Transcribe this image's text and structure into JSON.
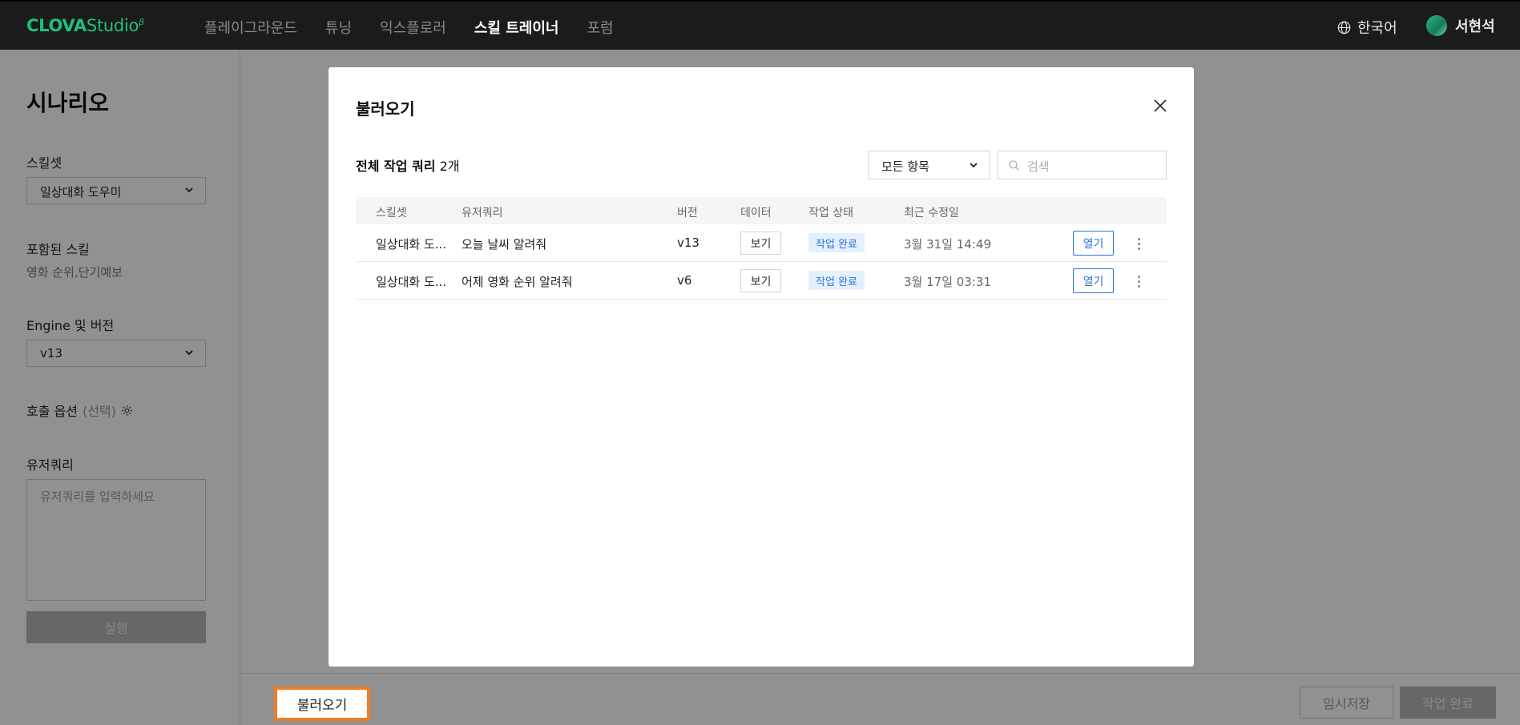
{
  "topbar": {
    "logo_brand": "CLOVA",
    "logo_product": "Studio",
    "logo_mark": "β",
    "nav": [
      "플레이그라운드",
      "튜닝",
      "익스플로러",
      "스킬 트레이너",
      "포럼"
    ],
    "active_nav_index": 3,
    "language": "한국어",
    "user_name": "서현석",
    "icons": {
      "language": "globe-icon",
      "user": "avatar"
    }
  },
  "sidebar": {
    "title": "시나리오",
    "skillset_label": "스킬셋",
    "skillset_value": "일상대화 도우미",
    "included_skills_label": "포함된 스킬",
    "included_skills_value": "영화 순위,단기예보",
    "engine_label": "Engine 및 버전",
    "engine_value": "v13",
    "call_options_label": "호출 옵션",
    "call_options_optional": "(선택)",
    "user_query_label": "유저쿼리",
    "user_query_placeholder": "유저쿼리를 입력하세요",
    "run_button": "실행"
  },
  "footer": {
    "load_button": "불러오기",
    "temp_save_button": "임시저장",
    "complete_button": "작업 완료"
  },
  "modal": {
    "title": "불러오기",
    "count_prefix": "전체 작업 쿼리",
    "count_value": "2개",
    "filter_value": "모든 항목",
    "search_placeholder": "검색",
    "columns": [
      "스킬셋",
      "유저쿼리",
      "버전",
      "데이터",
      "작업 상태",
      "최근 수정일"
    ],
    "rows": [
      {
        "skillset": "일상대화 도...",
        "query": "오늘 날씨 알려줘",
        "version": "v13",
        "data_button": "보기",
        "status": "작업 완료",
        "modified": "3월 31일 14:49",
        "open_button": "열기"
      },
      {
        "skillset": "일상대화 도...",
        "query": "어제 영화 순위 알려줘",
        "version": "v6",
        "data_button": "보기",
        "status": "작업 완료",
        "modified": "3월 17일 03:31",
        "open_button": "열기"
      }
    ]
  },
  "colors": {
    "brand_green": "#1fc07a",
    "accent_blue": "#2a73d8",
    "highlight_orange": "#ef7d22"
  }
}
